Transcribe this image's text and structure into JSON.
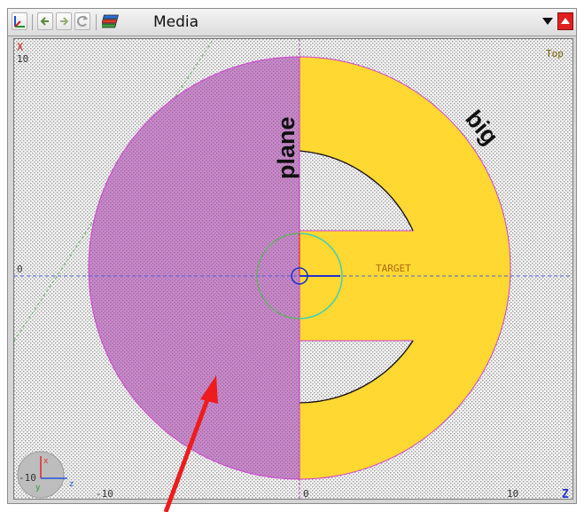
{
  "toolbar": {
    "media_label": "Media",
    "icons": [
      "axes-icon",
      "arrow-left-icon",
      "arrow-right-icon",
      "refresh-icon",
      "layers-icon",
      "dropdown-arrow-icon",
      "collapse-up-icon"
    ]
  },
  "viewport": {
    "view_name": "Top",
    "axis_top_left": "X",
    "tick_top_left": "10",
    "tick_left_zero": "0",
    "tick_bottom_neg10": "-10",
    "tick_bottom_zero": "0",
    "tick_bottom_10": "10",
    "axis_bottom_right": "Z",
    "gizmo_value": "-10",
    "gizmo_x": "x",
    "gizmo_y": "y",
    "gizmo_z": "z"
  },
  "labels": {
    "plane": "plane",
    "big": "big",
    "target": "TARGET"
  },
  "colors": {
    "plane_fill": "#c68ac8",
    "big_fill": "#ffd832",
    "background": "#f2f2f2",
    "axis_dash": "#4d5fe0",
    "grid_dash": "#5ab45a",
    "pointer_arrow": "#ee1c1c",
    "close_button": "#e02020"
  }
}
